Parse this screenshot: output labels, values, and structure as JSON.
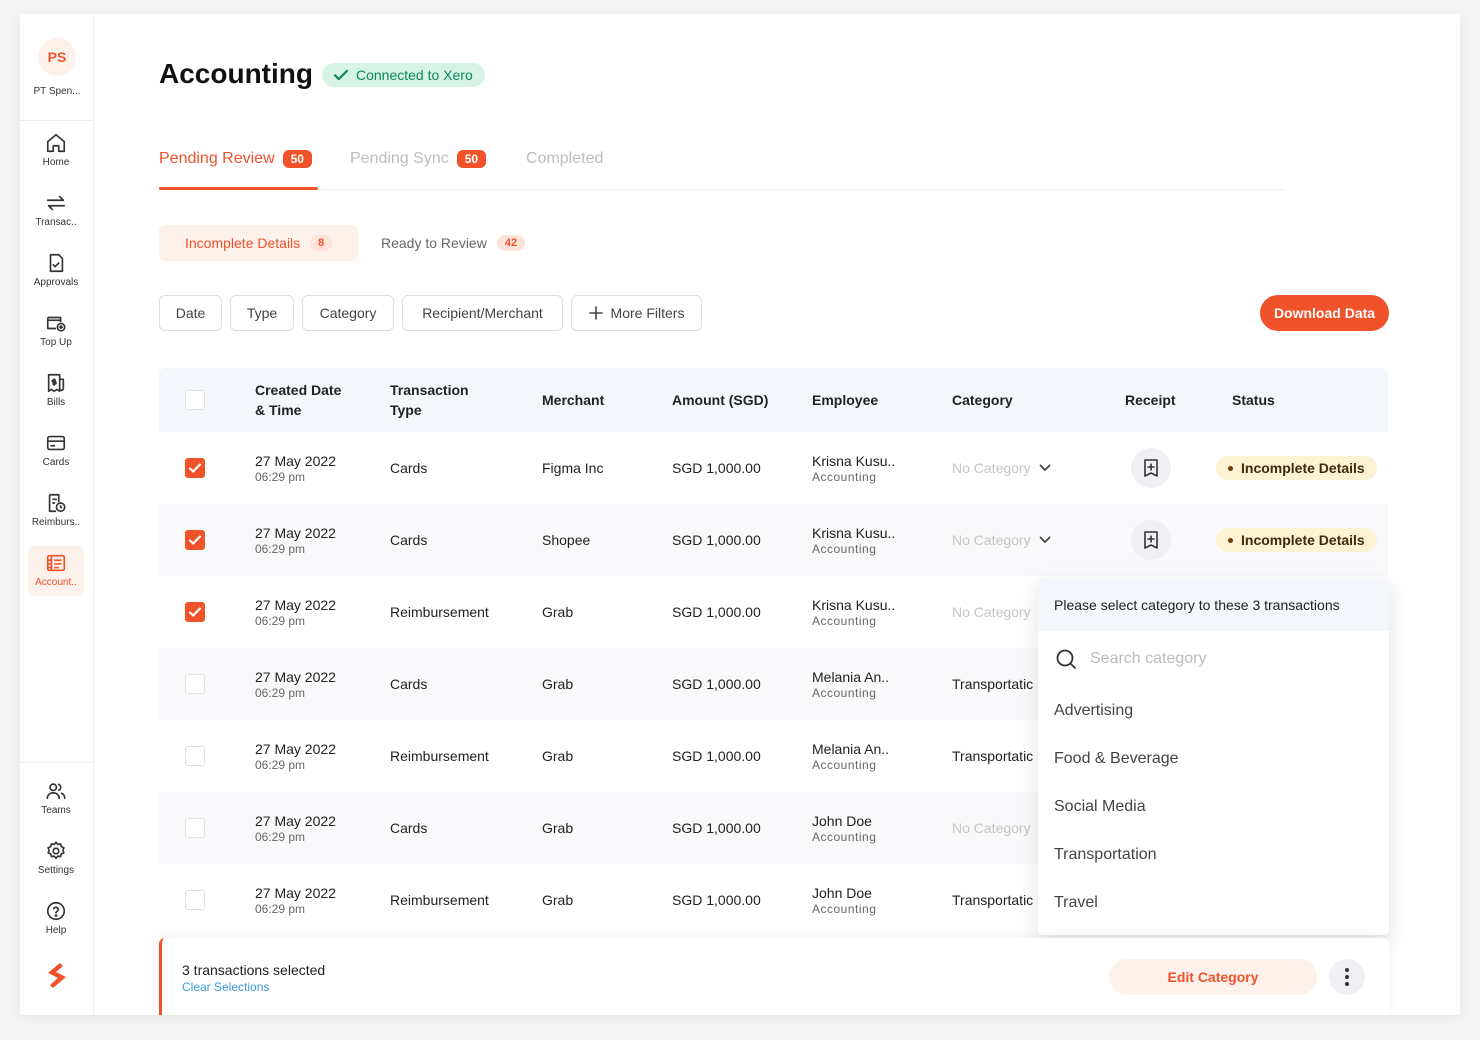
{
  "org": {
    "initials": "PS",
    "name": "PT Spen..."
  },
  "nav": [
    {
      "label": "Home",
      "icon": "home-icon"
    },
    {
      "label": "Transac..",
      "icon": "transfer-icon"
    },
    {
      "label": "Approvals",
      "icon": "document-check-icon"
    },
    {
      "label": "Top Up",
      "icon": "wallet-plus-icon"
    },
    {
      "label": "Bills",
      "icon": "bill-icon"
    },
    {
      "label": "Cards",
      "icon": "card-icon"
    },
    {
      "label": "Reimburs..",
      "icon": "receipt-clock-icon"
    },
    {
      "label": "Account..",
      "icon": "ledger-icon",
      "active": true
    }
  ],
  "bottom_nav": [
    {
      "label": "Teams",
      "icon": "users-icon"
    },
    {
      "label": "Settings",
      "icon": "gear-icon"
    },
    {
      "label": "Help",
      "icon": "help-icon"
    }
  ],
  "page": {
    "title": "Accounting",
    "badge": "Connected to Xero"
  },
  "tabs": [
    {
      "label": "Pending Review",
      "count": "50",
      "active": true
    },
    {
      "label": "Pending Sync",
      "count": "50"
    },
    {
      "label": "Completed"
    }
  ],
  "subtabs": [
    {
      "label": "Incomplete Details",
      "count": "8",
      "active": true
    },
    {
      "label": "Ready to Review",
      "count": "42"
    }
  ],
  "filters": [
    "Date",
    "Type",
    "Category",
    "Recipient/Merchant",
    "More Filters"
  ],
  "download_label": "Download Data",
  "table": {
    "headers": [
      "Created Date & Time",
      "Transaction Type",
      "Merchant",
      "Amount (SGD)",
      "Employee",
      "Category",
      "Receipt",
      "Status"
    ],
    "header_lines": {
      "created": [
        "Created Date",
        "& Time"
      ],
      "type": [
        "Transaction",
        "Type"
      ]
    },
    "rows": [
      {
        "checked": true,
        "date": "27 May 2022",
        "time": "06:29 pm",
        "type": "Cards",
        "merchant": "Figma Inc",
        "amount": "SGD 1,000.00",
        "employee": "Krisna Kusu..",
        "dept": "Accounting",
        "category": "No Category",
        "has_category": false,
        "status": "Incomplete Details"
      },
      {
        "checked": true,
        "date": "27 May 2022",
        "time": "06:29 pm",
        "type": "Cards",
        "merchant": "Shopee",
        "amount": "SGD 1,000.00",
        "employee": "Krisna Kusu..",
        "dept": "Accounting",
        "category": "No Category",
        "has_category": false,
        "status": "Incomplete Details"
      },
      {
        "checked": true,
        "date": "27 May 2022",
        "time": "06:29 pm",
        "type": "Reimbursement",
        "merchant": "Grab",
        "amount": "SGD 1,000.00",
        "employee": "Krisna Kusu..",
        "dept": "Accounting",
        "category": "No Category",
        "has_category": false
      },
      {
        "checked": false,
        "date": "27 May 2022",
        "time": "06:29 pm",
        "type": "Cards",
        "merchant": "Grab",
        "amount": "SGD 1,000.00",
        "employee": "Melania An..",
        "dept": "Accounting",
        "category": "Transportatic",
        "has_category": true
      },
      {
        "checked": false,
        "date": "27 May 2022",
        "time": "06:29 pm",
        "type": "Reimbursement",
        "merchant": "Grab",
        "amount": "SGD 1,000.00",
        "employee": "Melania An..",
        "dept": "Accounting",
        "category": "Transportatic",
        "has_category": true
      },
      {
        "checked": false,
        "date": "27 May 2022",
        "time": "06:29 pm",
        "type": "Cards",
        "merchant": "Grab",
        "amount": "SGD 1,000.00",
        "employee": "John Doe",
        "dept": "Accounting",
        "category": "No Category",
        "has_category": false
      },
      {
        "checked": false,
        "date": "27 May 2022",
        "time": "06:29 pm",
        "type": "Reimbursement",
        "merchant": "Grab",
        "amount": "SGD 1,000.00",
        "employee": "John Doe",
        "dept": "Accounting",
        "category": "Transportatic",
        "has_category": true
      }
    ]
  },
  "dropdown": {
    "header": "Please select category to these 3 transactions",
    "search_placeholder": "Search category",
    "options": [
      "Advertising",
      "Food & Beverage",
      "Social Media",
      "Transportation",
      "Travel"
    ]
  },
  "selection": {
    "count_text": "3 transactions selected",
    "clear_label": "Clear Selections",
    "edit_label": "Edit Category"
  },
  "colors": {
    "accent": "#f0522a",
    "success": "#0b8a57",
    "warning_bg": "#fdf3d3",
    "link": "#3b9ad9"
  }
}
